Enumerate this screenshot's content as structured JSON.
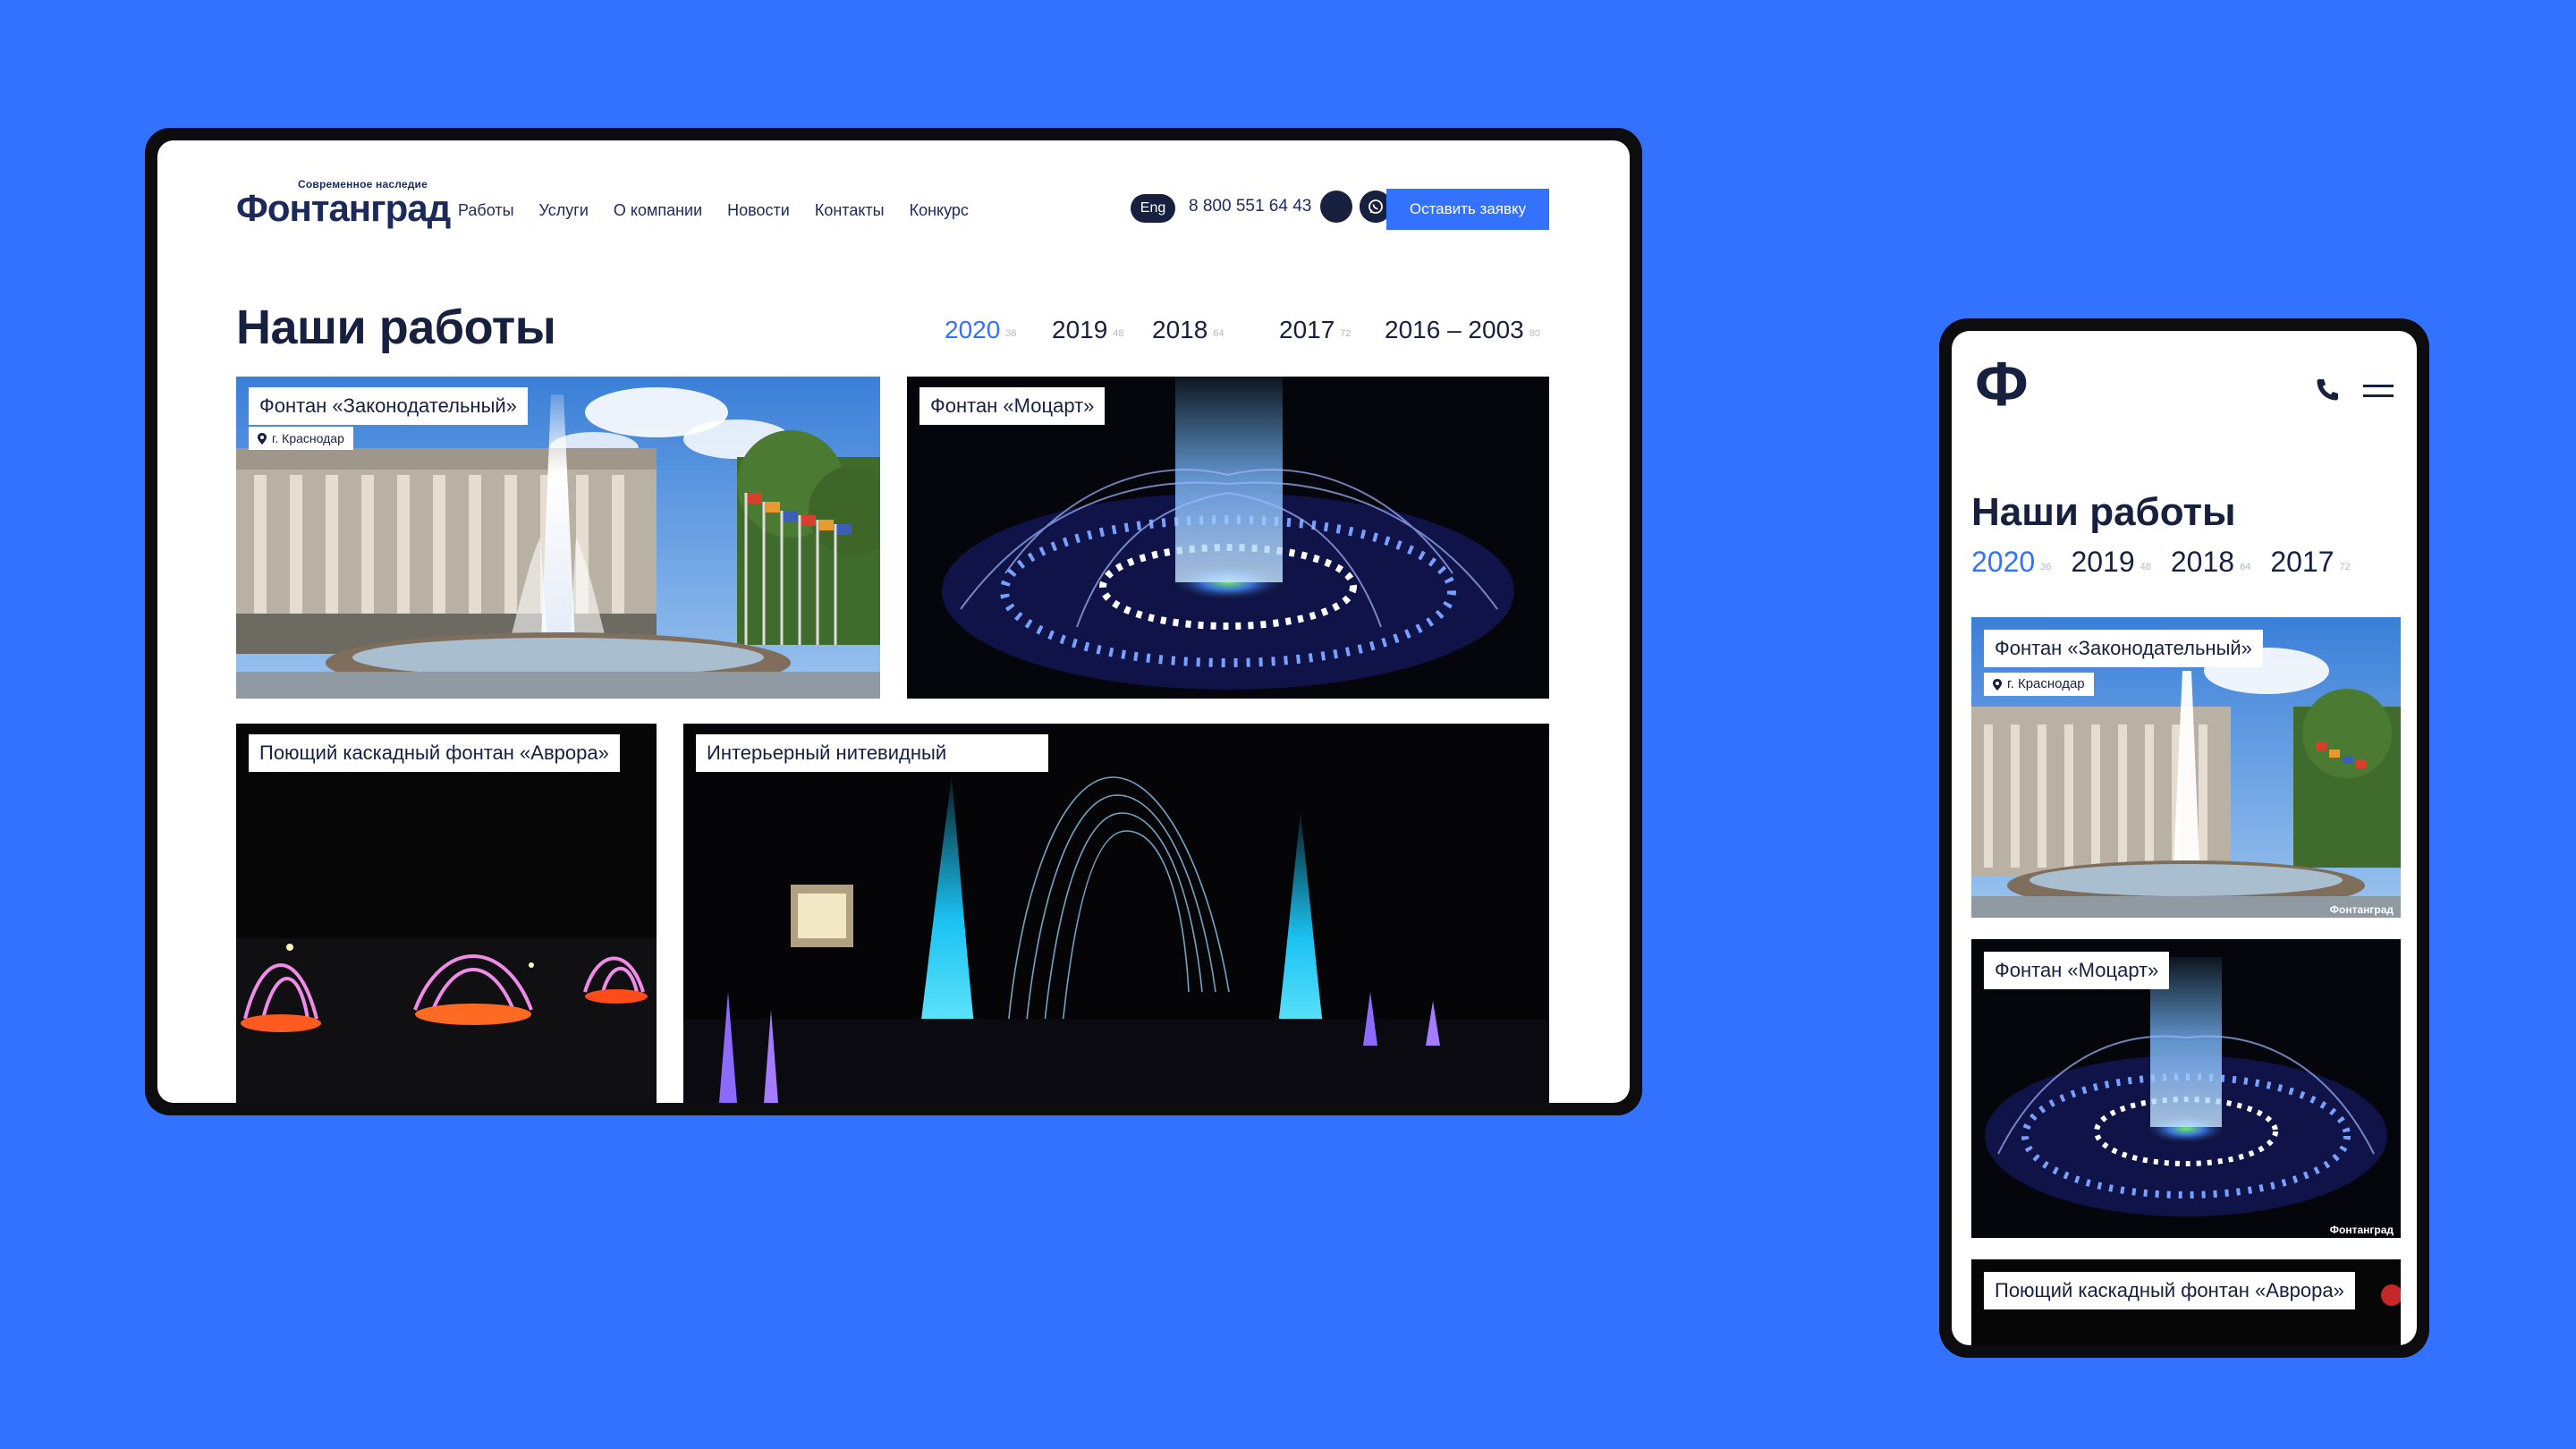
{
  "desktop": {
    "logo_small": "Современное наследие",
    "logo": "Фонтанград",
    "nav": [
      "Работы",
      "Услуги",
      "О компании",
      "Новости",
      "Контакты",
      "Конкурс"
    ],
    "lang": "Eng",
    "phone": "8 800 551 64 43",
    "cta": "Оставить заявку",
    "page_title": "Наши работы",
    "years": [
      {
        "label": "2020",
        "count": "36",
        "active": true
      },
      {
        "label": "2019",
        "count": "48",
        "active": false
      },
      {
        "label": "2018",
        "count": "64",
        "active": false
      },
      {
        "label": "2017",
        "count": "72",
        "active": false
      },
      {
        "label": "2016 – 2003",
        "count": "80",
        "active": false
      }
    ],
    "cards": [
      {
        "title": "Фонтан «Законодательный»",
        "location": "г. Краснодар"
      },
      {
        "title": "Фонтан «Моцарт»"
      },
      {
        "title": "Поющий каскадный фонтан «Аврора»"
      },
      {
        "title": "Интерьерный нитевидный"
      }
    ]
  },
  "mobile": {
    "logo": "Ф",
    "page_title": "Наши работы",
    "years": [
      {
        "label": "2020",
        "count": "36",
        "active": true
      },
      {
        "label": "2019",
        "count": "48",
        "active": false
      },
      {
        "label": "2018",
        "count": "64",
        "active": false
      },
      {
        "label": "2017",
        "count": "72",
        "active": false
      }
    ],
    "cards": [
      {
        "title": "Фонтан «Законодательный»",
        "location": "г. Краснодар",
        "watermark": "Фонтанград"
      },
      {
        "title": "Фонтан «Моцарт»",
        "watermark": "Фонтанград"
      },
      {
        "title": "Поющий каскадный фонтан «Аврора»"
      }
    ]
  },
  "colors": {
    "background": "#3272fe",
    "accent": "#3272fe",
    "navy": "#17213f"
  },
  "icons": [
    "pin-icon",
    "telegram-icon",
    "whatsapp-icon",
    "phone-icon",
    "menu-icon"
  ]
}
